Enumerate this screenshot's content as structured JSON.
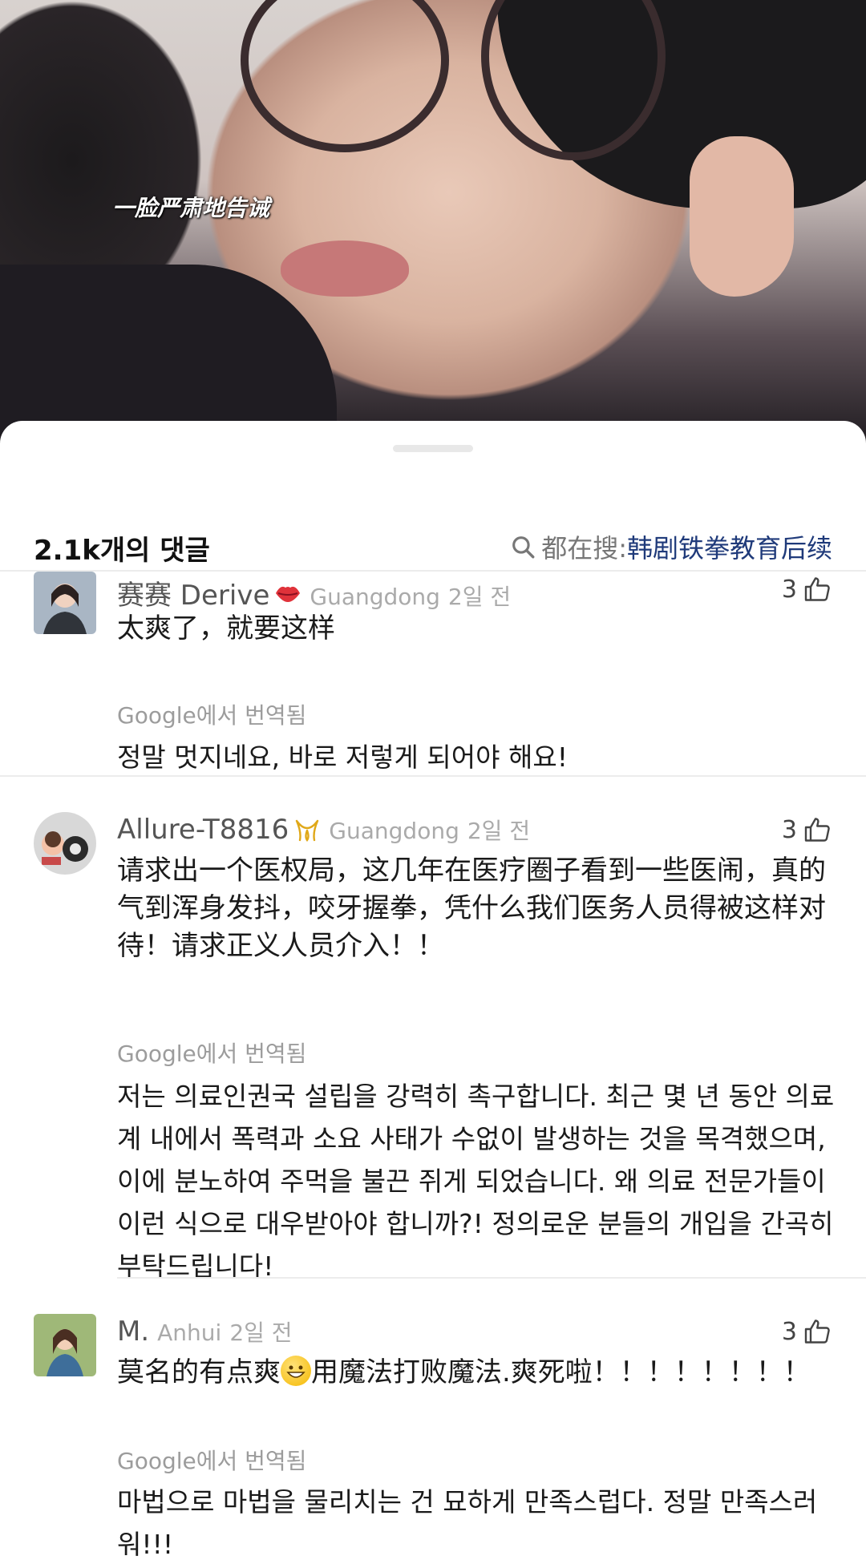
{
  "video": {
    "caption": "一脸严肃地告诫"
  },
  "header": {
    "comment_count": "2.1k개의 댓글",
    "search_prefix": "都在搜:",
    "search_term": "韩剧铁拳教育后续"
  },
  "comments": [
    {
      "name": "赛赛 Derive",
      "badge_icon": "lips-icon",
      "location": "Guangdong",
      "time": "2일 전",
      "likes": "3",
      "text": "太爽了，就要这样",
      "translation_label": "Google에서 번역됨",
      "translation": "정말 멋지네요, 바로 저렇게 되어야 해요!"
    },
    {
      "name": "Allure-T8816",
      "badge_icon": "ribbon-icon",
      "location": "Guangdong",
      "time": "2일 전",
      "likes": "3",
      "text": "请求出一个医权局，这几年在医疗圈子看到一些医闹，真的气到浑身发抖，咬牙握拳，凭什么我们医务人员得被这样对待！请求正义人员介入！！",
      "translation_label": "Google에서 번역됨",
      "translation": "저는 의료인권국 설립을 강력히 촉구합니다. 최근 몇 년 동안 의료계 내에서 폭력과 소요 사태가 수없이 발생하는 것을 목격했으며, 이에 분노하여 주먹을 불끈 쥐게 되었습니다. 왜 의료 전문가들이 이런 식으로 대우받아야 합니까?! 정의로운 분들의 개입을 간곡히 부탁드립니다!"
    },
    {
      "name": "M.",
      "location": "Anhui",
      "time": "2일 전",
      "likes": "3",
      "text_before": "莫名的有点爽",
      "text_emoji": "grinning-face-icon",
      "text_after": "用魔法打败魔法.爽死啦！！！！！！！！",
      "translation_label": "Google에서 번역됨",
      "translation": "마법으로 마법을 물리치는 건 묘하게 만족스럽다. 정말 만족스러워!!!"
    }
  ]
}
